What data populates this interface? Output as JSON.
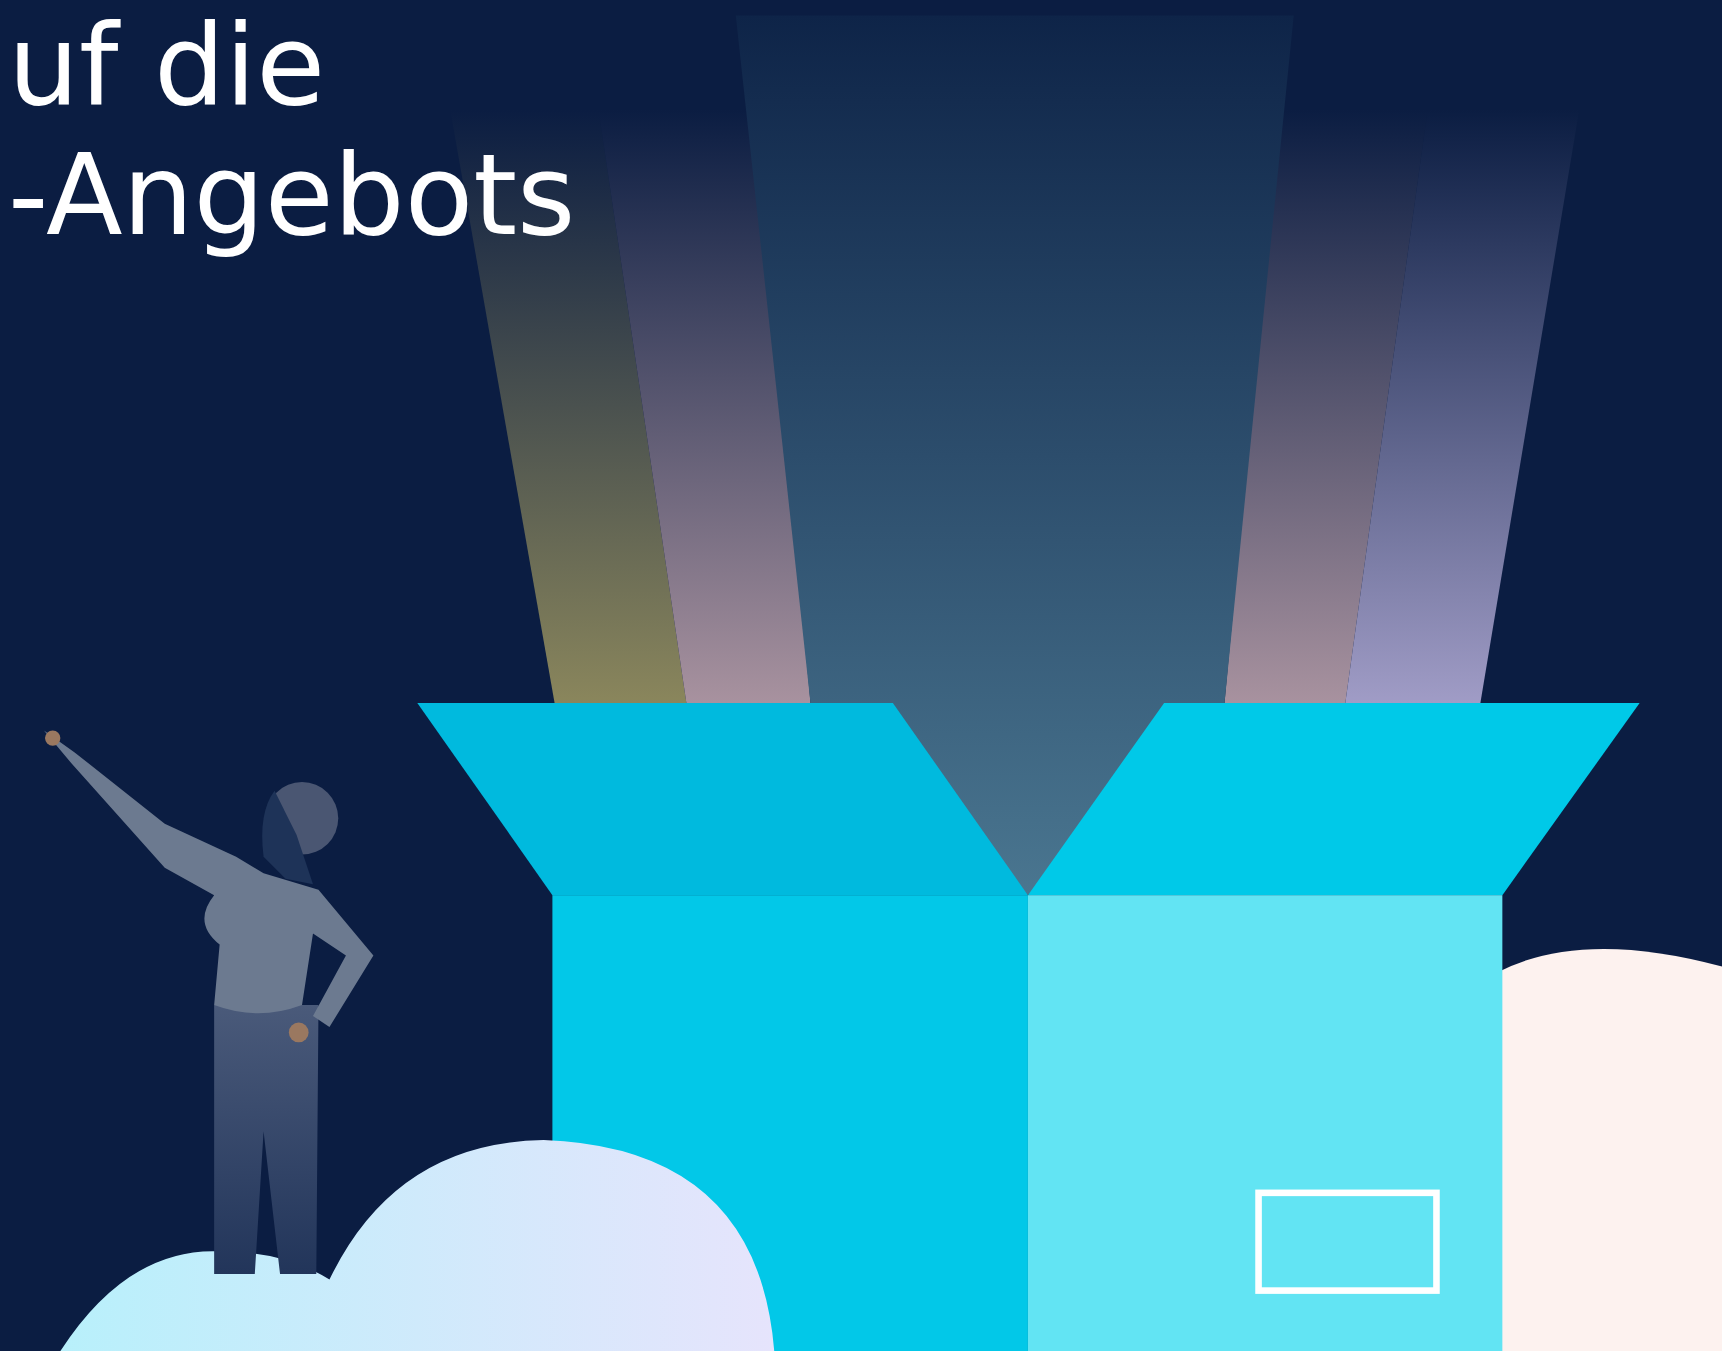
{
  "heading": {
    "lines": [
      "uf die",
      "-Angebots"
    ]
  }
}
